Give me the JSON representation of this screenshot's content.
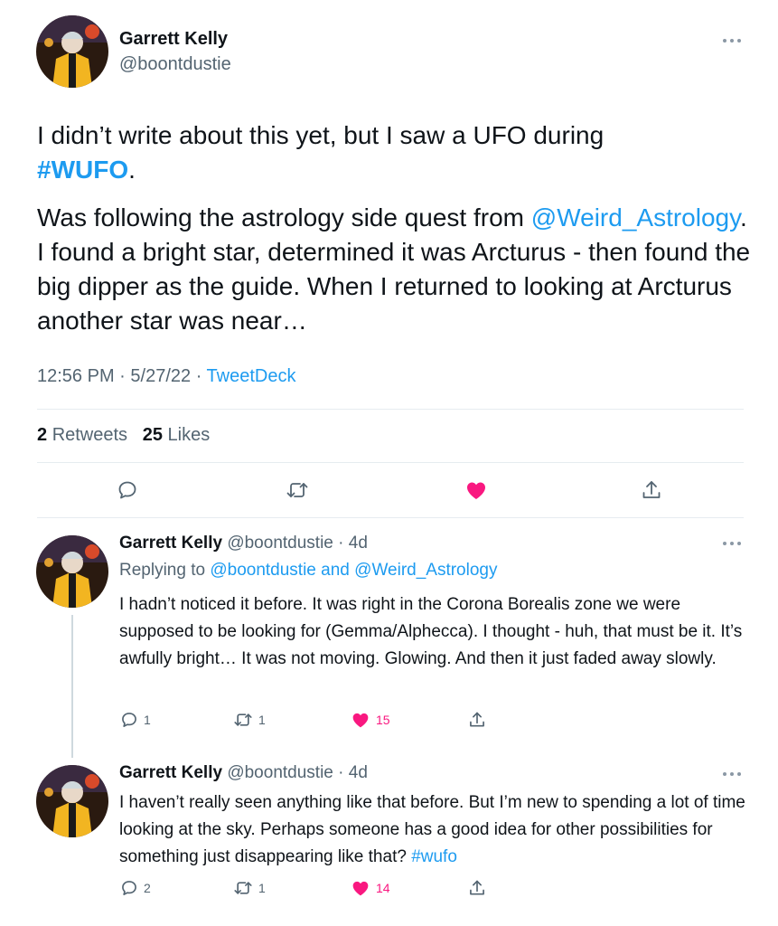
{
  "colors": {
    "link": "#1d9bf0",
    "muted": "#536471",
    "like": "#f91880"
  },
  "main_tweet": {
    "name": "Garrett Kelly",
    "handle": "@boontdustie",
    "text_p1": "I didn’t write about this yet, but I saw a UFO during",
    "hashtag": "#WUFO",
    "hashtag_suffix": ".",
    "text_p2_a": "Was following the astrology side quest from",
    "mention": "@Weird_Astrology",
    "text_p2_b": ". I found a bright star, determined it was Arcturus - then found the big dipper as the guide. When I returned to looking at Arcturus another star was near…",
    "time": "12:56 PM",
    "date": "5/27/22",
    "source": "TweetDeck",
    "retweets_count": "2",
    "retweets_label": "Retweets",
    "likes_count": "25",
    "likes_label": "Likes",
    "icons": [
      "reply-icon",
      "retweet-icon",
      "like-icon",
      "share-icon"
    ]
  },
  "replies": [
    {
      "name": "Garrett Kelly",
      "handle": "@boontdustie",
      "age": "4d",
      "replying_label": "Replying to",
      "replying_user1": "@boontdustie",
      "replying_and": "and",
      "replying_user2": "@Weird_Astrology",
      "text": "I hadn’t noticed it before. It was right in the Corona Borealis zone we were supposed to be looking for (Gemma/Alphecca). I thought - huh, that must be it. It’s awfully bright… It was not moving. Glowing. And then it just faded away slowly.",
      "reply_count": "1",
      "retweet_count": "1",
      "like_count": "15"
    },
    {
      "name": "Garrett Kelly",
      "handle": "@boontdustie",
      "age": "4d",
      "text": "I haven’t really seen anything like that before. But I’m new to spending a lot of time looking at the sky. Perhaps someone has a good idea for other possibilities for something just disappearing like that?",
      "hashtag": "#wufo",
      "reply_count": "2",
      "retweet_count": "1",
      "like_count": "14"
    }
  ]
}
